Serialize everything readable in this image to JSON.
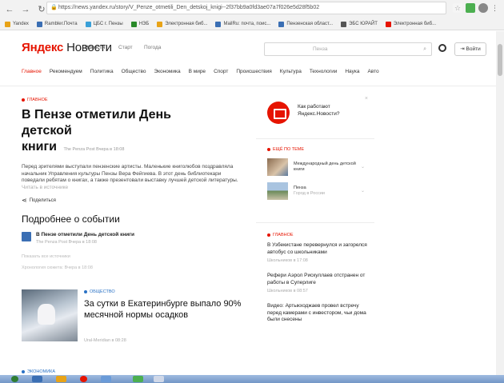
{
  "browser": {
    "url": "https://news.yandex.ru/story/V_Penze_otmetili_Den_detskoj_knigi--2f37bb9a0fd3ae07a7f026e5d28f5b02",
    "bookmarks": [
      {
        "label": "Yandex",
        "color": "#e8a317"
      },
      {
        "label": "Rambler.Почта",
        "color": "#3b6fb4"
      },
      {
        "label": "ЦБС г. Пензы",
        "color": "#3aa0d8"
      },
      {
        "label": "НЭБ",
        "color": "#2a8a2a"
      },
      {
        "label": "Электронная биб...",
        "color": "#e8a317"
      },
      {
        "label": "MailRu: почта, поис...",
        "color": "#3b6fb4"
      },
      {
        "label": "Пензенская област...",
        "color": "#3b6fb4"
      },
      {
        "label": "ЭБС ЮРАЙТ",
        "color": "#555555"
      },
      {
        "label": "Электронная биб...",
        "color": "#e61400"
      }
    ]
  },
  "header": {
    "logo_brand": "Яндекс",
    "logo_service": "Новости",
    "nav": [
      "Новости",
      "Старт",
      "Погода"
    ],
    "search_placeholder": "Пенза",
    "login_label": "Войти"
  },
  "rubrics": [
    "Главное",
    "Рекомендуем",
    "Политика",
    "Общество",
    "Экономика",
    "В мире",
    "Спорт",
    "Происшествия",
    "Культура",
    "Технологии",
    "Наука",
    "Авто"
  ],
  "main": {
    "tag": "ГЛАВНОЕ",
    "headline_1": "В Пензе отметили День детской",
    "headline_2": "книги",
    "headline_src": "The Penza Post  Вчера в 18:08",
    "annotation": "Перед зрителями выступали пензенские артисты. Маленькие книголюбов поздравляла начальник Управления культуры Пензы Вера Фейгиева. В этот день библиотекари поведали ребятам о книгах, а также презентовали выставку лучшей детской литературы.",
    "annotation_more": "Читать в источнике",
    "share_label": "Поделиться",
    "section_title": "Подробнее о событии",
    "related": {
      "title": "В Пензе отметили День детской книги",
      "source": "The Penza Post  Вчера в 18:08"
    },
    "grey_line_1": "Показать все источники",
    "grey_line_2": "Хронология сюжета: Вчера в 18:08",
    "story2": {
      "tag": "ОБЩЕСТВО",
      "title": "За сутки в Екатеринбурге выпало 90% месячной нормы осадков",
      "time": "Ural-Meridian в 08:28"
    },
    "bottom_tag": "ЭКОНОМИКА"
  },
  "side": {
    "promo_text": "Как работают Яндекс.Новости?",
    "bytheme_tag": "ЕЩЁ ПО ТЕМЕ",
    "theme_items": [
      {
        "title": "Международный день детской книги",
        "sub": ""
      },
      {
        "title": "Пенза",
        "sub": "Город в России"
      }
    ],
    "news_tag": "ГЛАВНОЕ",
    "news": [
      {
        "title": "В Узбекистане перевернулся и загорелся автобус со школьниками",
        "time": "Школьников в 17:08"
      },
      {
        "title": "Рефери Аэрол Рискуллаев отстранен от работы в Суперлиге",
        "time": "Школьников в 08:57"
      },
      {
        "title": "Видео: Артыкходжаев провел встречу перед камерами с инвестором, чьи дома были снесены",
        "time": ""
      }
    ]
  }
}
